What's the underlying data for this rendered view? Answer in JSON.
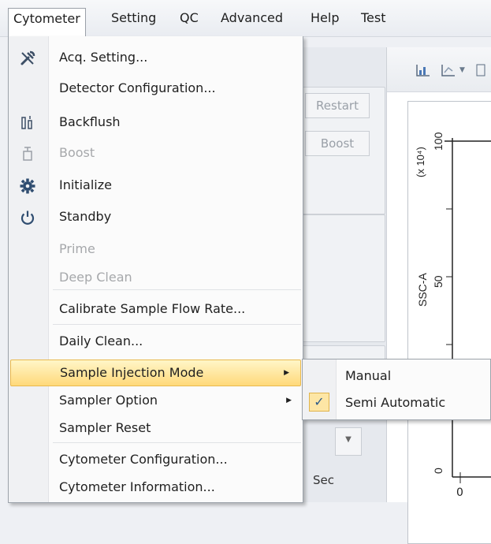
{
  "menubar": {
    "items": [
      "Cytometer",
      "Setting",
      "QC",
      "Advanced",
      "Help",
      "Test"
    ],
    "active": "Cytometer"
  },
  "background": {
    "restart_label": "Restart",
    "boost_label": "Boost",
    "sec_label": "Sec",
    "axis_exponent": "(x 10⁴)",
    "y_tick_top": "100",
    "y_tick_mid": "50",
    "y_axis_label": "SSC-A",
    "x_tick_zero": "0",
    "y_tick_zero": "0"
  },
  "cytometer_menu": {
    "items": [
      {
        "label": "Acq. Setting...",
        "icon": "wrench-screwdriver-icon",
        "enabled": true
      },
      {
        "label": "Detector Configuration...",
        "icon": "",
        "enabled": true
      },
      {
        "label": "Backflush",
        "icon": "backflush-icon",
        "enabled": true
      },
      {
        "label": "Boost",
        "icon": "boost-icon",
        "enabled": false
      },
      {
        "label": "Initialize",
        "icon": "gear-icon",
        "enabled": true
      },
      {
        "label": "Standby",
        "icon": "power-icon",
        "enabled": true
      },
      {
        "label": "Prime",
        "icon": "",
        "enabled": false
      },
      {
        "label": "Deep Clean",
        "icon": "",
        "enabled": false
      },
      {
        "label": "Calibrate Sample Flow Rate...",
        "icon": "",
        "enabled": true
      },
      {
        "label": "Daily Clean...",
        "icon": "",
        "enabled": true
      },
      {
        "label": "Sample Injection Mode",
        "icon": "",
        "enabled": true,
        "submenu": true,
        "highlighted": true
      },
      {
        "label": "Sampler Option",
        "icon": "",
        "enabled": true,
        "submenu": true
      },
      {
        "label": "Sampler Reset",
        "icon": "",
        "enabled": true
      },
      {
        "label": "Cytometer Configuration...",
        "icon": "",
        "enabled": true
      },
      {
        "label": "Cytometer Information...",
        "icon": "",
        "enabled": true
      }
    ]
  },
  "injection_submenu": {
    "items": [
      {
        "label": "Manual",
        "checked": false
      },
      {
        "label": "Semi Automatic",
        "checked": true
      }
    ],
    "check_mark": "✓"
  },
  "colors": {
    "highlight_top": "#fff6c8",
    "highlight_bottom": "#ffd97a",
    "disabled_text": "#a6a8ab",
    "icon_blue": "#3d4f66"
  }
}
